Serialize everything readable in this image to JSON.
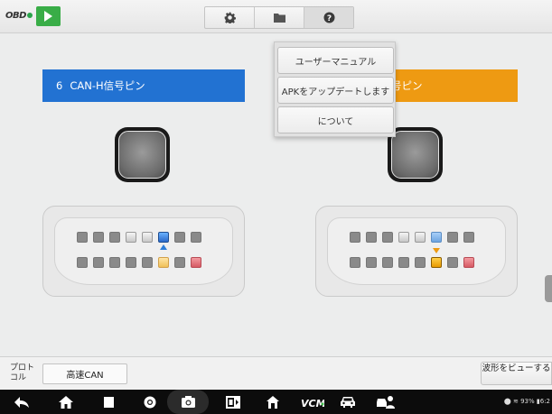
{
  "topbar": {
    "logo_text": "OBD",
    "tools": [
      "settings",
      "folder",
      "help"
    ]
  },
  "dropdown": {
    "items": [
      "ユーザーマニュアル",
      "APKをアップデートします",
      "について"
    ]
  },
  "channel_left": {
    "pin_number": "6",
    "label": "CAN-H信号ピン",
    "color": "#2272d2"
  },
  "channel_right": {
    "label_visible": "号ピン",
    "color": "#ee9a12"
  },
  "bottom": {
    "protocol_label": "プロトコル",
    "protocol_value": "高速CAN",
    "waveform_button": "波形をビューする"
  },
  "status": {
    "battery": "93%",
    "time": "6:2"
  },
  "icons": [
    "back-icon",
    "home-icon",
    "recent-apps-icon",
    "chrome-icon",
    "camera-icon",
    "screen-record-icon",
    "autel-home-icon",
    "vcm-icon",
    "car-icon",
    "remote-expert-icon"
  ]
}
